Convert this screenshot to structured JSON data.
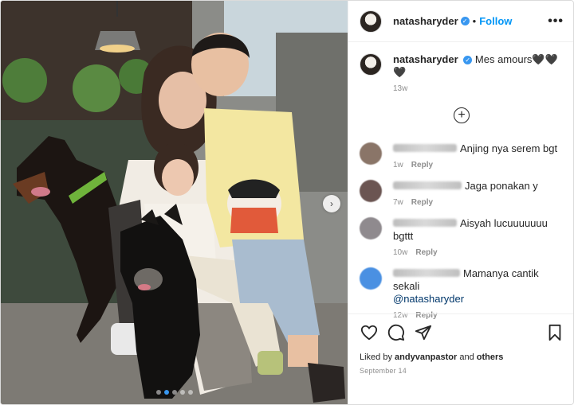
{
  "post": {
    "username": "natasharyder",
    "follow_label": "Follow",
    "separator": "•",
    "more_label": "•••",
    "caption_text": "Mes amours🖤🖤🖤",
    "caption_time": "13w",
    "load_more_symbol": "+",
    "carousel_next": "›",
    "carousel_slides": 5,
    "carousel_active_index": 1
  },
  "comments": [
    {
      "text": "Anjing nya serem bgt",
      "time": "1w",
      "reply_label": "Reply",
      "user_blur_width": 80,
      "avatar_color": "#8a7568"
    },
    {
      "text": "Jaga ponakan y",
      "time": "7w",
      "reply_label": "Reply",
      "user_blur_width": 86,
      "avatar_color": "#6b5552"
    },
    {
      "text": "Aisyah lucuuuuuuu bgttt",
      "time": "10w",
      "reply_label": "Reply",
      "user_blur_width": 40,
      "avatar_color": "#8f8a8e"
    },
    {
      "text": "Mamanya cantik sekali",
      "mention": "@natasharyder",
      "time": "12w",
      "reply_label": "Reply",
      "user_blur_width": 84,
      "avatar_color": "#4a90e2"
    }
  ],
  "footer": {
    "liked_by_prefix": "Liked by ",
    "liked_by_user": "andyvanpastor",
    "liked_by_and": " and ",
    "liked_by_others": "others",
    "date": "September 14"
  },
  "icons": [
    "like-icon",
    "comment-icon",
    "share-icon",
    "save-icon",
    "verified-badge-icon",
    "add-comment-icon",
    "chevron-right-icon"
  ]
}
